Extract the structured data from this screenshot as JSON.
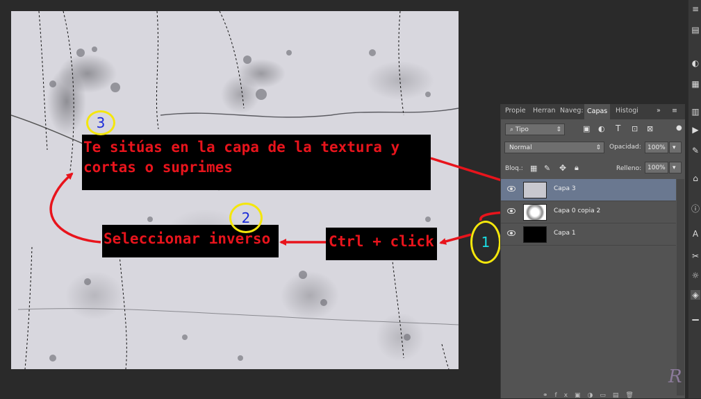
{
  "annotations": {
    "step3_text_line1": "Te sitúas en la capa de la textura y",
    "step3_text_line2": "cortas o suprimes",
    "step2_text": "Seleccionar inverso",
    "step1_text": "Ctrl + click",
    "step1_number": "1",
    "step2_number": "2",
    "step3_number": "3"
  },
  "panel": {
    "tabs": [
      "Propie",
      "Herran",
      "Naveg:",
      "Capas",
      "Histogi"
    ],
    "active_tab": "Capas",
    "filter_kind": "Tipo",
    "blend_mode": "Normal",
    "opacity_label": "Opacidad:",
    "opacity_value": "100%",
    "lock_label": "Bloq.:",
    "fill_label": "Relleno:",
    "fill_value": "100%",
    "layers": [
      {
        "name": "Capa 3",
        "selected": true
      },
      {
        "name": "Capa 0 copia 2",
        "selected": false
      },
      {
        "name": "Capa 1",
        "selected": false
      }
    ]
  },
  "colors": {
    "annotation_red": "#e8141c",
    "circle_yellow": "#f4e60c",
    "number_blue": "#1a2ad8",
    "number_cyan": "#19e0e6",
    "selected_layer": "#6a7890"
  },
  "watermark": "R"
}
